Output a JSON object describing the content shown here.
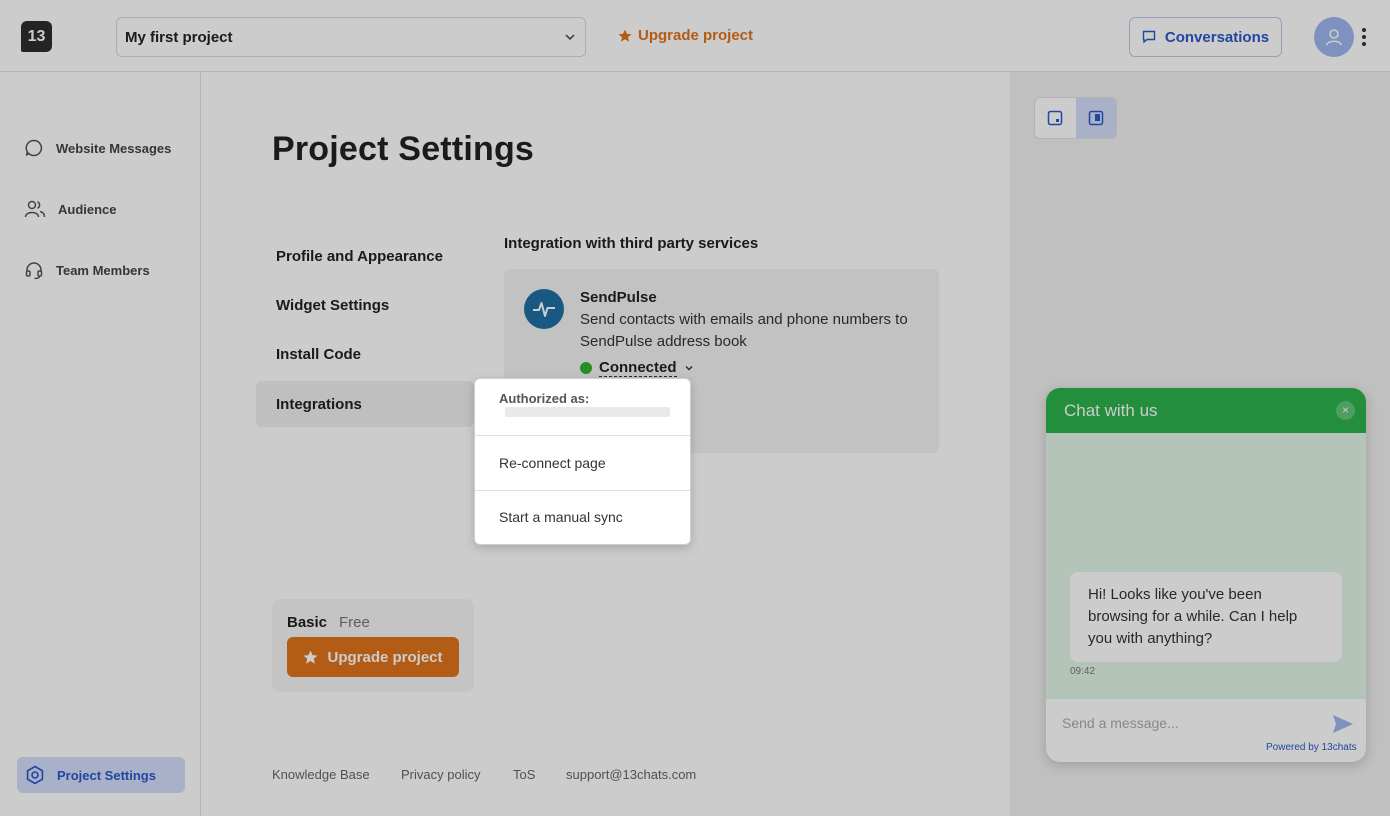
{
  "header": {
    "logo_text": "13",
    "project_name": "My first project",
    "upgrade_label": "Upgrade project",
    "conversations_label": "Conversations"
  },
  "sidebar": {
    "items": [
      {
        "label": "Website Messages",
        "icon": "chat-bubble-icon"
      },
      {
        "label": "Audience",
        "icon": "users-icon"
      },
      {
        "label": "Team Members",
        "icon": "headset-icon"
      }
    ],
    "active": {
      "label": "Project Settings",
      "icon": "settings-hexagon-icon"
    }
  },
  "main": {
    "title": "Project Settings",
    "tabs": [
      {
        "label": "Profile and Appearance"
      },
      {
        "label": "Widget Settings"
      },
      {
        "label": "Install Code"
      },
      {
        "label": "Integrations",
        "active": true
      }
    ],
    "section_title": "Integration with third party services",
    "integration": {
      "name": "SendPulse",
      "description": "Send contacts with emails and phone numbers to SendPulse address book",
      "status": "Connected",
      "status_color": "#2db52d"
    },
    "plan": {
      "name": "Basic",
      "tier": "Free",
      "upgrade_label": "Upgrade project"
    },
    "footer_links": [
      "Knowledge Base",
      "Privacy policy",
      "ToS",
      "support@13chats.com"
    ]
  },
  "dropdown": {
    "authorized_label": "Authorized as:",
    "reconnect_label": "Re-connect page",
    "manual_sync_label": "Start a manual sync"
  },
  "chat_widget": {
    "header": "Chat with us",
    "close": "×",
    "message": "Hi! Looks like you've been browsing for a while. Can I help you with anything?",
    "time": "09:42",
    "input_placeholder": "Send a message...",
    "powered_by": "Powered by 13chats",
    "header_color": "#2cb34b"
  },
  "colors": {
    "accent": "#2a57c9",
    "upgrade": "#e0731b"
  }
}
